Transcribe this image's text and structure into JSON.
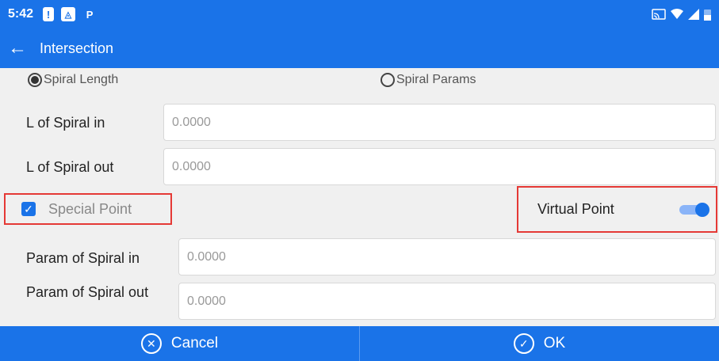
{
  "status_bar": {
    "time": "5:42",
    "icons": [
      "alert-icon",
      "maps-icon",
      "parking-icon",
      "cast-icon",
      "wifi-icon",
      "signal-icon",
      "battery-icon"
    ]
  },
  "app_bar": {
    "title": "Intersection",
    "back_icon": "arrow-left-icon"
  },
  "spiral_mode": {
    "options": [
      "Spiral Length",
      "Spiral Params"
    ],
    "selected": "Spiral Length"
  },
  "fields": {
    "l_spiral_in": {
      "label": "L of Spiral in",
      "value": "0.0000"
    },
    "l_spiral_out": {
      "label": "L of Spiral out",
      "value": "0.0000"
    },
    "param_spiral_in": {
      "label": "Param of Spiral in",
      "value": "0.0000"
    },
    "param_spiral_out": {
      "label": "Param of Spiral out",
      "value": "0.0000"
    }
  },
  "special_point": {
    "label": "Special Point",
    "checked": true
  },
  "virtual_point": {
    "label": "Virtual Point",
    "on": true
  },
  "actions": {
    "cancel_label": "Cancel",
    "ok_label": "OK"
  },
  "colors": {
    "primary": "#1a73e8",
    "highlight": "#e53935"
  }
}
